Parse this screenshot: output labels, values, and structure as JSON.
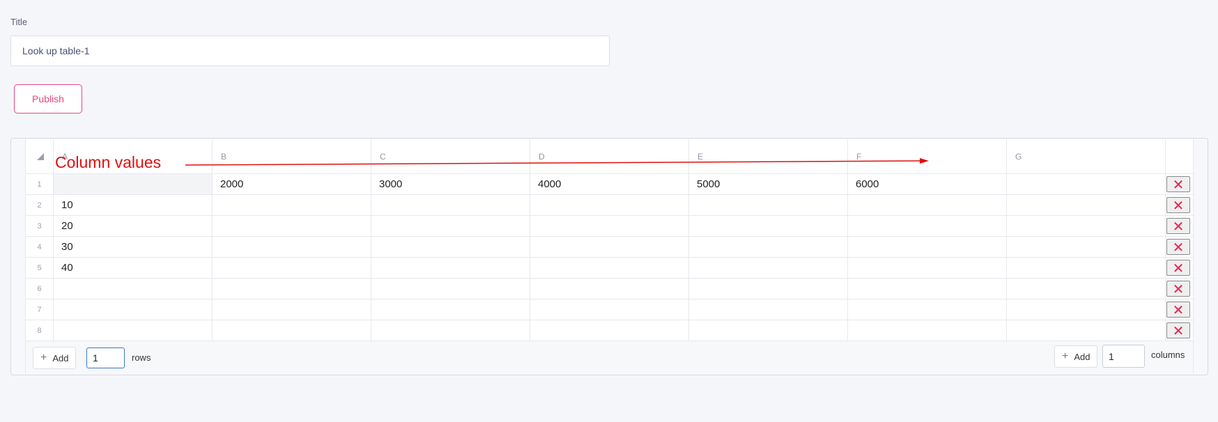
{
  "form": {
    "title_label": "Title",
    "title_value": "Look up table-1",
    "publish_label": "Publish"
  },
  "table": {
    "columns": [
      "A",
      "B",
      "C",
      "D",
      "E",
      "F",
      "G"
    ],
    "row_numbers": [
      "1",
      "2",
      "3",
      "4",
      "5",
      "6",
      "7",
      "8"
    ],
    "rows": [
      [
        "",
        "2000",
        "3000",
        "4000",
        "5000",
        "6000",
        ""
      ],
      [
        "10",
        "",
        "",
        "",
        "",
        "",
        ""
      ],
      [
        "20",
        "",
        "",
        "",
        "",
        "",
        ""
      ],
      [
        "30",
        "",
        "",
        "",
        "",
        "",
        ""
      ],
      [
        "40",
        "",
        "",
        "",
        "",
        "",
        ""
      ],
      [
        "",
        "",
        "",
        "",
        "",
        "",
        ""
      ],
      [
        "",
        "",
        "",
        "",
        "",
        "",
        ""
      ],
      [
        "",
        "",
        "",
        "",
        "",
        "",
        ""
      ]
    ],
    "delete_glyph": "✕"
  },
  "annotation": {
    "text": "Column values",
    "color": "#e01010"
  },
  "footer": {
    "add_label": "Add",
    "plus_glyph": "+",
    "rows_count": "1",
    "rows_label": "rows",
    "columns_count": "1",
    "columns_label": "columns"
  },
  "colors": {
    "accent": "#e04a7a",
    "delete": "#e8244e",
    "focus": "#3b78c4"
  }
}
